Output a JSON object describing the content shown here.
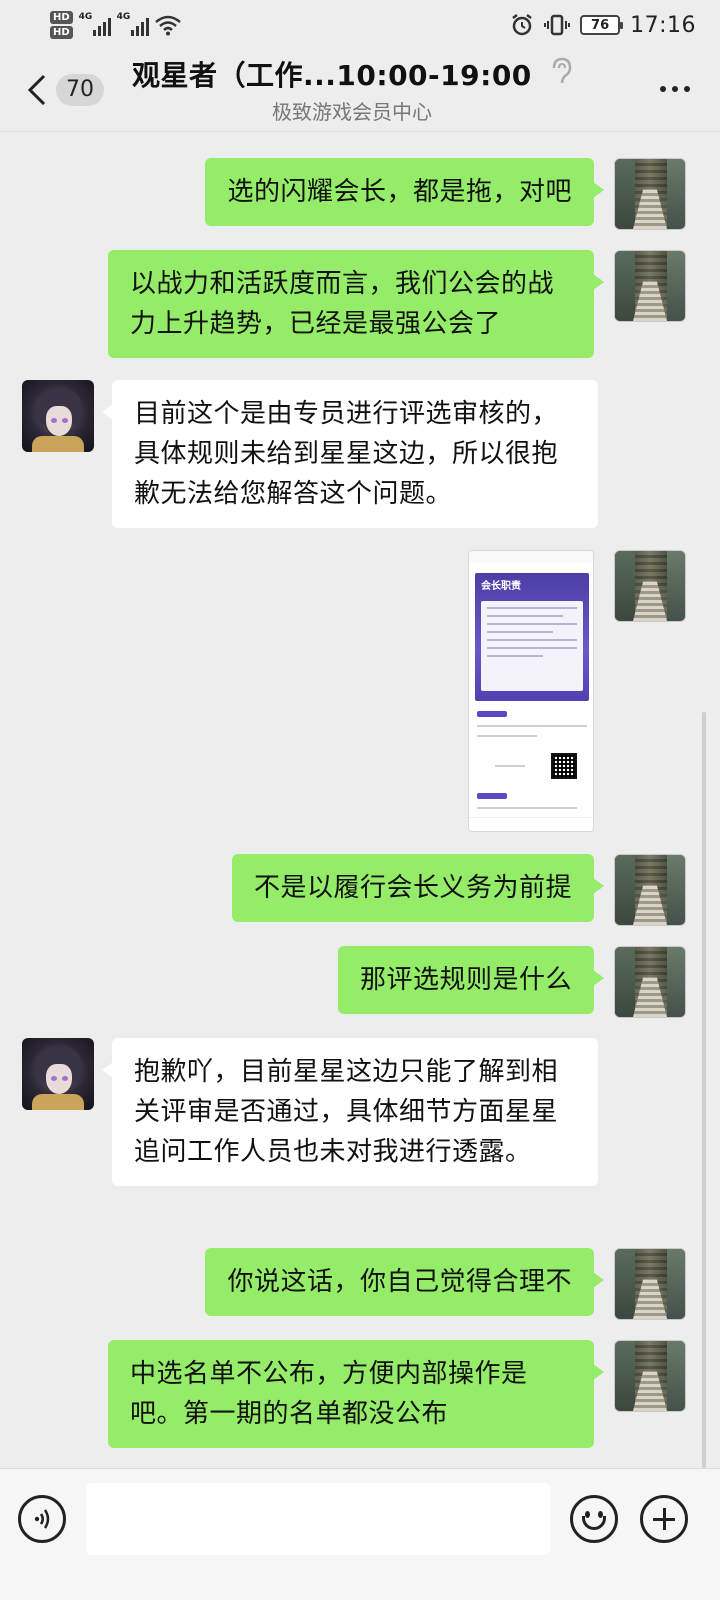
{
  "status_bar": {
    "hd1": "HD",
    "hd2": "HD",
    "net1": "4G",
    "net2": "4G",
    "battery": "76",
    "time": "17:16"
  },
  "header": {
    "unread_count": "70",
    "title": "观星者（工作...10:00-19:00）",
    "subtitle": "极致游戏会员中心"
  },
  "messages": [
    {
      "side": "out",
      "text": "选的闪耀会长，都是拖，对吧"
    },
    {
      "side": "out",
      "text": "以战力和活跃度而言，我们公会的战力上升趋势，已经是最强公会了"
    },
    {
      "side": "in",
      "text": "目前这个是由专员进行评选审核的，具体规则未给到星星这边，所以很抱歉无法给您解答这个问题。"
    },
    {
      "side": "out",
      "type": "image",
      "image_heading": "会长职责"
    },
    {
      "side": "out",
      "text": "不是以履行会长义务为前提"
    },
    {
      "side": "out",
      "text": "那评选规则是什么"
    },
    {
      "side": "in",
      "text": "抱歉吖，目前星星这边只能了解到相关评审是否通过，具体细节方面星星追问工作人员也未对我进行透露。"
    },
    {
      "side": "out",
      "text": "你说这话，你自己觉得合理不"
    },
    {
      "side": "out",
      "text": "中选名单不公布，方便内部操作是吧。第一期的名单都没公布"
    }
  ],
  "input_bar": {
    "placeholder": ""
  },
  "colors": {
    "background": "#ededed",
    "outgoing_bubble": "#95ec69",
    "incoming_bubble": "#ffffff"
  }
}
